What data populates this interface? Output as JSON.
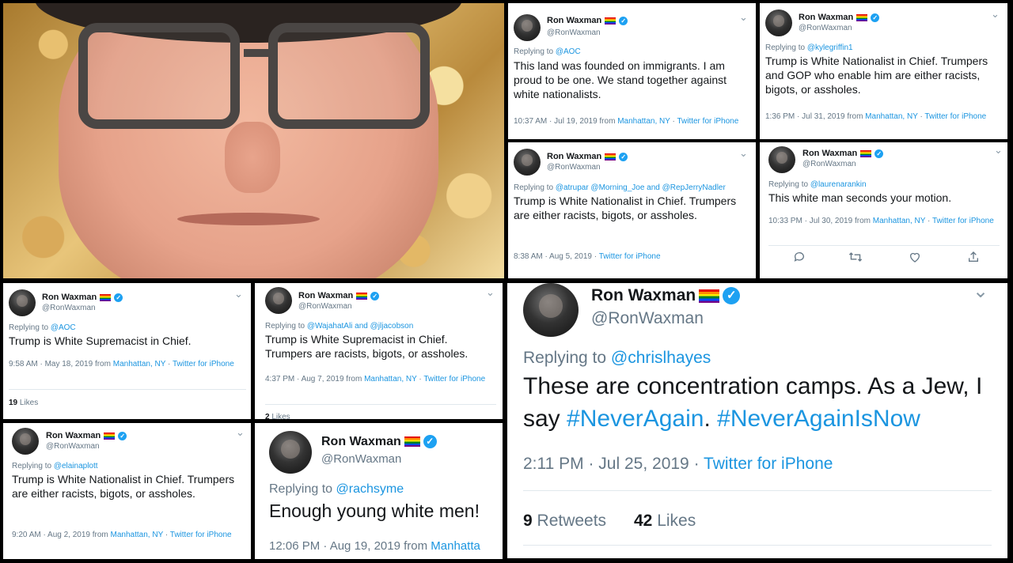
{
  "user": {
    "name": "Ron Waxman",
    "handle": "@RonWaxman"
  },
  "tweets": [
    {
      "reply_prefix": "Replying to ",
      "reply_to": "@AOC",
      "text": "This land was founded on immigrants.  I am proud to be one.  We stand together against white nationalists.",
      "time": "10:37 AM · Jul 19, 2019 from ",
      "location": "Manhattan, NY",
      "dot": " · ",
      "source": "Twitter for iPhone"
    },
    {
      "reply_prefix": "Replying to ",
      "reply_to": "@kylegriffin1",
      "text": "Trump is White Nationalist in Chief.  Trumpers and GOP who enable him are either racists, bigots, or assholes.",
      "time": "1:36 PM · Jul 31, 2019 from ",
      "location": "Manhattan, NY",
      "dot": " · ",
      "source": "Twitter for iPhone"
    },
    {
      "reply_prefix": "Replying to ",
      "reply_to": "@atrupar @Morning_Joe and @RepJerryNadler",
      "text": "Trump is White Nationalist in Chief. Trumpers are either racists, bigots, or assholes.",
      "time": "8:38 AM · Aug 5, 2019",
      "location": "",
      "dot": " · ",
      "source": "Twitter for iPhone"
    },
    {
      "reply_prefix": "Replying to ",
      "reply_to": "@laurenarankin",
      "text": "This white man seconds your motion.",
      "time": "10:33 PM · Jul 30, 2019 from ",
      "location": "Manhattan, NY",
      "dot": " · ",
      "source": "Twitter for iPhone"
    },
    {
      "reply_prefix": "Replying to ",
      "reply_to": "@AOC",
      "text": "Trump is White Supremacist in Chief.",
      "time": "9:58 AM · May 18, 2019 from ",
      "location": "Manhattan, NY",
      "dot": " · ",
      "source": "Twitter for iPhone",
      "likes_count": "19",
      "likes_label": " Likes"
    },
    {
      "reply_prefix": "Replying to ",
      "reply_to": "@WajahatAli and @jljacobson",
      "text": "Trump is White Supremacist in Chief. Trumpers are racists, bigots, or assholes.",
      "time": "4:37 PM · Aug 7, 2019 from ",
      "location": "Manhattan, NY",
      "dot": " · ",
      "source": "Twitter for iPhone",
      "likes_count": "2",
      "likes_label": " Likes"
    },
    {
      "reply_prefix": "Replying to ",
      "reply_to": "@elainaplott",
      "text": "Trump is White Nationalist in Chief. Trumpers are either racists, bigots, or assholes.",
      "time": "9:20 AM · Aug 2, 2019 from ",
      "location": "Manhattan, NY",
      "dot": " · ",
      "source": "Twitter for iPhone"
    },
    {
      "reply_prefix": "Replying to ",
      "reply_to": "@rachsyme",
      "text": "Enough young white men!",
      "time": "12:06 PM · Aug 19, 2019 from ",
      "location": "Manhatta",
      "dot": "",
      "source": ""
    },
    {
      "reply_prefix": "Replying to ",
      "reply_to": "@chrislhayes",
      "text_a": "These are concentration camps.  As a Jew, I say ",
      "tag1": "#NeverAgain",
      "text_b": ".  ",
      "tag2": "#NeverAgainIsNow",
      "time": "2:11 PM · Jul 25, 2019",
      "dot": " · ",
      "source": "Twitter for iPhone",
      "retweets_count": "9",
      "retweets_label": " Retweets",
      "likes_count": "42",
      "likes_label": " Likes"
    }
  ],
  "icons": {
    "verified": "✓",
    "chevron": "⌄"
  },
  "colors": {
    "link": "#1b95e0",
    "verified": "#1da1f2",
    "muted": "#657786"
  }
}
